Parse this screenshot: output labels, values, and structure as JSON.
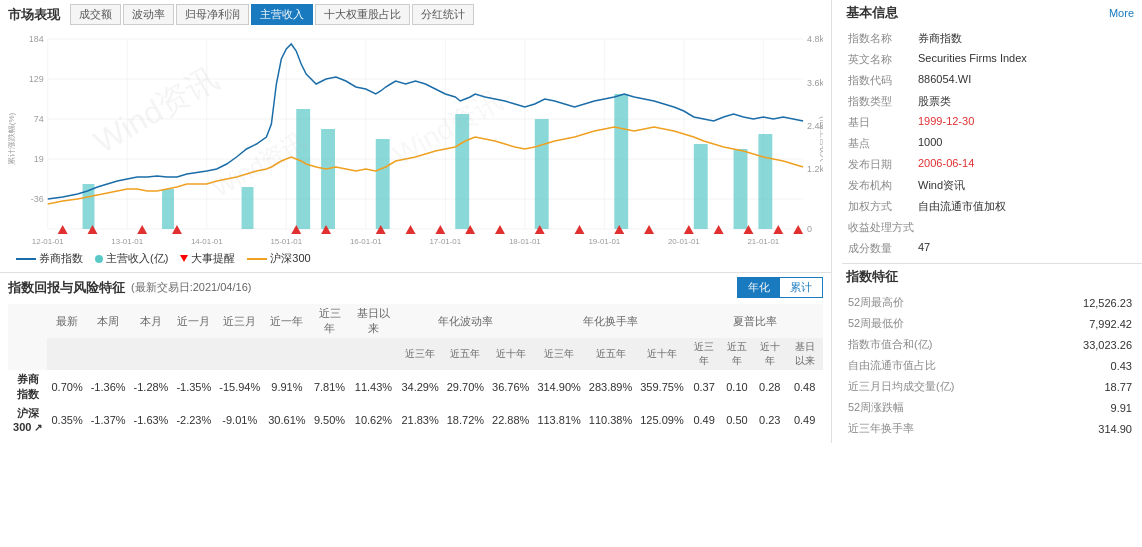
{
  "market": {
    "title": "市场表现",
    "tabs": [
      {
        "label": "成交额",
        "active": false
      },
      {
        "label": "波动率",
        "active": false
      },
      {
        "label": "归母净利润",
        "active": false
      },
      {
        "label": "主营收入",
        "active": true
      },
      {
        "label": "十大权重股占比",
        "active": false
      },
      {
        "label": "分红统计",
        "active": false
      }
    ],
    "legend": [
      {
        "type": "line",
        "color": "#1a7abf",
        "label": "券商指数"
      },
      {
        "type": "dot",
        "color": "#5bc8c8",
        "label": "主营收入(亿)"
      },
      {
        "type": "triangle",
        "color": "#e03030",
        "label": "大事提醒"
      },
      {
        "type": "line",
        "color": "#f0a020",
        "label": "沪深300"
      }
    ],
    "yaxis_left": [
      "184",
      "129",
      "74",
      "19",
      "-36"
    ],
    "yaxis_right": [
      "4.8k",
      "3.6k",
      "2.4k",
      "1.2k",
      "0"
    ],
    "yaxis_right_label": "(亿)主营收入",
    "yaxis_left_label": "累计涨跌幅(%)",
    "xaxis": [
      "12-01-01",
      "13-01-01",
      "14-01-01",
      "15-01-01",
      "16-01-01",
      "17-01-01",
      "18-01-01",
      "19-01-01",
      "20-01-01",
      "21-01-01"
    ]
  },
  "returns": {
    "title": "指数回报与风险特征",
    "date": "(最新交易日:2021/04/16)",
    "annualized_btn": [
      "年化",
      "累计"
    ],
    "active_btn": "年化",
    "columns": {
      "returns": [
        "最新",
        "本周",
        "本月",
        "近一月",
        "近三月",
        "近一年",
        "近三年",
        "基日以来"
      ],
      "volatility_sub": [
        "近三年",
        "近五年",
        "近十年"
      ],
      "turnover_sub": [
        "近三年",
        "近五年",
        "近十年"
      ],
      "sharpe_sub": [
        "近三年",
        "近五年",
        "近十年",
        "基日以来"
      ]
    },
    "groups": [
      {
        "label": "年化波动率",
        "colspan": 3
      },
      {
        "label": "年化换手率",
        "colspan": 3
      },
      {
        "label": "夏普比率",
        "colspan": 4
      }
    ],
    "rows": [
      {
        "label": "券商指数",
        "returns": [
          "0.70%",
          "-1.36%",
          "-1.28%",
          "-1.35%",
          "-15.94%",
          "9.91%",
          "7.81%",
          "11.43%"
        ],
        "returns_colors": [
          "red",
          "red",
          "red",
          "red",
          "red",
          "green",
          "green",
          "red"
        ],
        "volatility": [
          "34.29%",
          "29.70%",
          "36.76%"
        ],
        "turnover": [
          "314.90%",
          "283.89%",
          "359.75%"
        ],
        "sharpe": [
          "0.37",
          "0.10",
          "0.28",
          "0.48"
        ]
      },
      {
        "label": "沪深300",
        "label_suffix": "↗",
        "returns": [
          "0.35%",
          "-1.37%",
          "-1.63%",
          "-2.23%",
          "-9.01%",
          "30.61%",
          "9.50%",
          "10.62%"
        ],
        "returns_colors": [
          "green",
          "red",
          "red",
          "red",
          "red",
          "green",
          "green",
          "green"
        ],
        "volatility": [
          "21.83%",
          "18.72%",
          "22.88%"
        ],
        "turnover": [
          "113.81%",
          "110.38%",
          "125.09%"
        ],
        "sharpe": [
          "0.49",
          "0.50",
          "0.23",
          "0.49"
        ]
      }
    ]
  },
  "basic_info": {
    "title": "基本信息",
    "more": "More",
    "fields": [
      {
        "label": "指数名称",
        "value": "券商指数"
      },
      {
        "label": "英文名称",
        "value": "Securities Firms Index"
      },
      {
        "label": "指数代码",
        "value": "886054.WI"
      },
      {
        "label": "指数类型",
        "value": "股票类"
      },
      {
        "label": "基日",
        "value": "1999-12-30"
      },
      {
        "label": "基点",
        "value": "1000"
      },
      {
        "label": "发布日期",
        "value": "2006-06-14"
      },
      {
        "label": "发布机构",
        "value": "Wind资讯"
      },
      {
        "label": "加权方式",
        "value": "自由流通市值加权"
      },
      {
        "label": "收益处理方式",
        "value": ""
      },
      {
        "label": "成分数量",
        "value": "47"
      }
    ]
  },
  "index_char": {
    "title": "指数特征",
    "fields": [
      {
        "label": "52周最高价",
        "value": "12,526.23"
      },
      {
        "label": "52周最低价",
        "value": "7,992.42"
      },
      {
        "label": "指数市值合和(亿)",
        "value": "33,023.26"
      },
      {
        "label": "自由流通市值占比",
        "value": "0.43"
      },
      {
        "label": "近三月日均成交量(亿)",
        "value": "18.77"
      },
      {
        "label": "52周涨跌幅",
        "value": "9.91"
      },
      {
        "label": "近三年换手率",
        "value": "314.90"
      }
    ]
  }
}
